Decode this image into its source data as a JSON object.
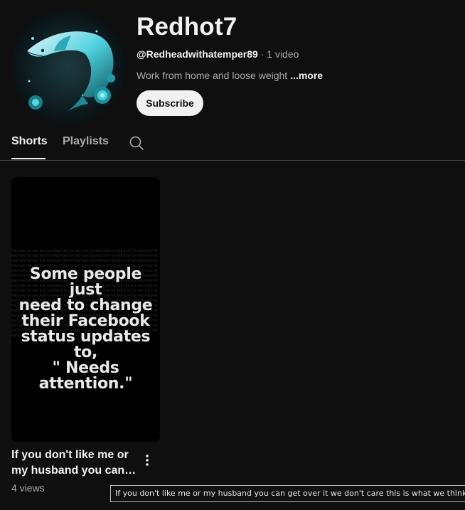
{
  "channel": {
    "name": "Redhot7",
    "handle": "@Redheadwithatemper89",
    "separator": "·",
    "video_count": "1 video",
    "description": "Work from home and loose weight",
    "more_label": "...more",
    "subscribe_label": "Subscribe",
    "avatar_icon": "dolphin-avatar-icon"
  },
  "tabs": [
    {
      "label": "Shorts",
      "active": true
    },
    {
      "label": "Playlists",
      "active": false
    }
  ],
  "search_icon": "search-icon",
  "shorts": [
    {
      "thumbnail_text": "Some people just\nneed to change\ntheir Facebook\nstatus updates to,\n\" Needs attention.\"",
      "title": "If you don't like me or my husband you can get over it we don't care this is what we think",
      "views": "4 views",
      "menu_icon": "more-vert-icon"
    }
  ],
  "tooltip": "If you don't like me or my husband you can get over it we don't care this is what we think",
  "colors": {
    "background": "#0f0f0f",
    "text_primary": "#f1f1f1",
    "text_secondary": "#aaaaaa",
    "subscribe_bg": "#f1f1f1",
    "avatar_accent": "#35c6d4"
  }
}
